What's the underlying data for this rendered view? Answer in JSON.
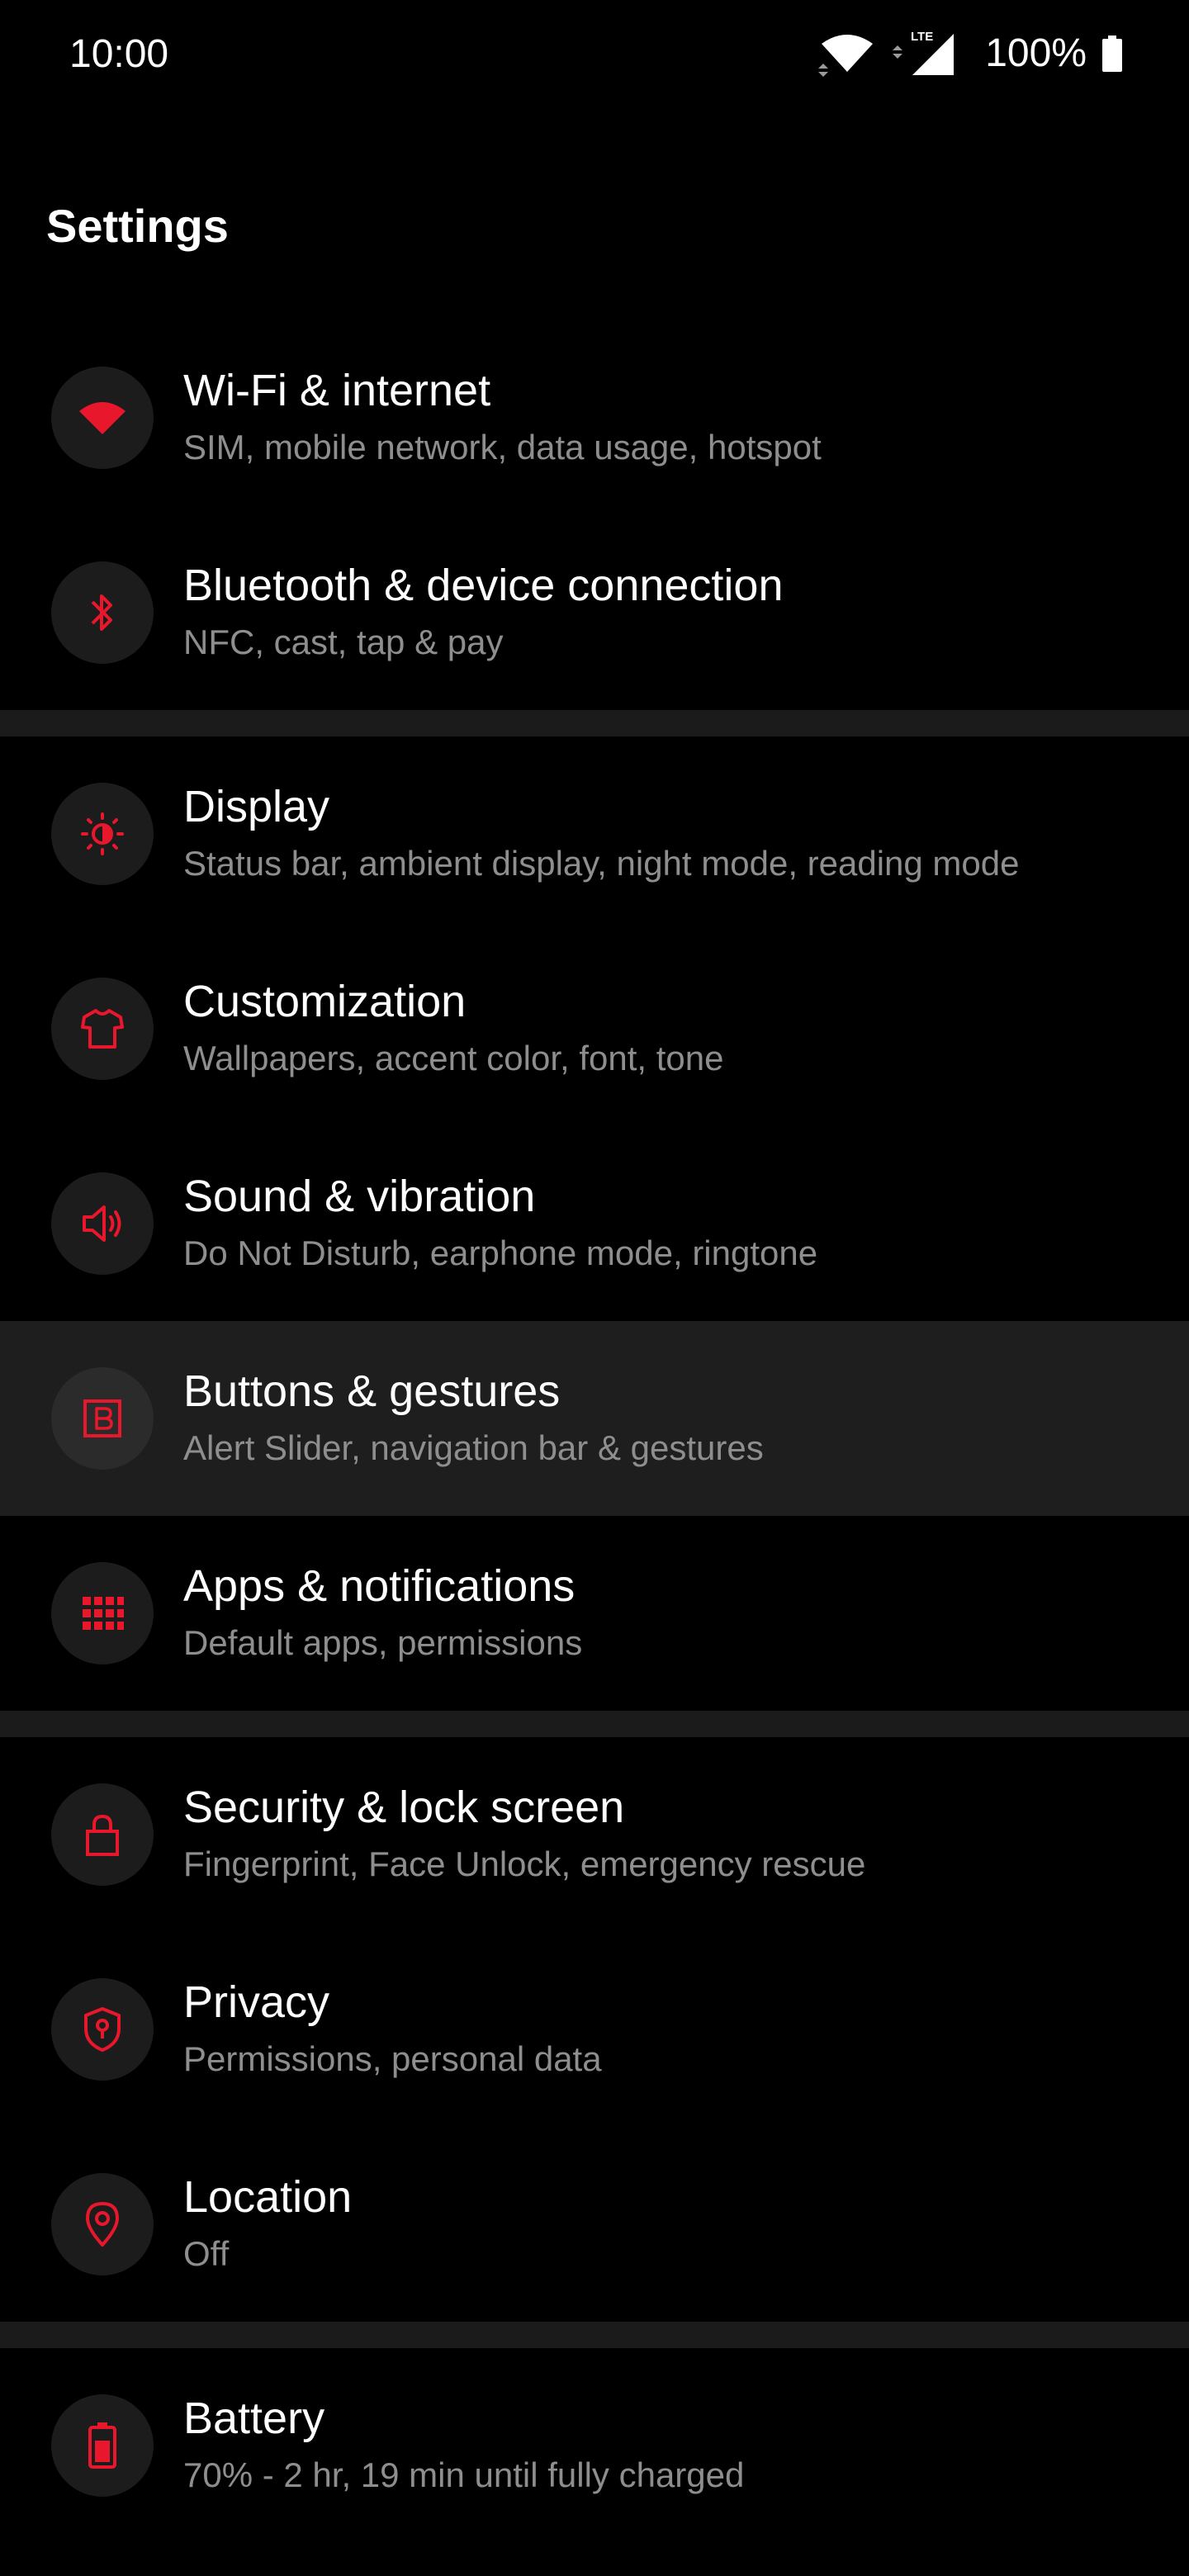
{
  "status_bar": {
    "time": "10:00",
    "battery_percent": "100%",
    "network_label": "LTE",
    "icons": [
      "wifi-icon",
      "mobile-signal-icon",
      "battery-icon"
    ]
  },
  "page": {
    "title": "Settings"
  },
  "accent_color": "#e8172c",
  "settings": [
    {
      "title": "Wi-Fi & internet",
      "subtitle": "SIM, mobile network, data usage, hotspot",
      "icon": "wifi-icon"
    },
    {
      "title": "Bluetooth & device connection",
      "subtitle": "NFC, cast, tap & pay",
      "icon": "bluetooth-icon"
    },
    {
      "title": "Display",
      "subtitle": "Status bar, ambient display, night mode, reading mode",
      "icon": "brightness-icon"
    },
    {
      "title": "Customization",
      "subtitle": "Wallpapers, accent color, font, tone",
      "icon": "tshirt-icon"
    },
    {
      "title": "Sound & vibration",
      "subtitle": "Do Not Disturb, earphone mode, ringtone",
      "icon": "speaker-icon"
    },
    {
      "title": "Buttons & gestures",
      "subtitle": "Alert Slider, navigation bar & gestures",
      "icon": "button-b-icon"
    },
    {
      "title": "Apps & notifications",
      "subtitle": "Default apps, permissions",
      "icon": "apps-grid-icon"
    },
    {
      "title": "Security & lock screen",
      "subtitle": "Fingerprint, Face Unlock, emergency rescue",
      "icon": "lock-icon"
    },
    {
      "title": "Privacy",
      "subtitle": "Permissions, personal data",
      "icon": "privacy-shield-icon"
    },
    {
      "title": "Location",
      "subtitle": "Off",
      "icon": "location-pin-icon"
    },
    {
      "title": "Battery",
      "subtitle": "70% - 2 hr, 19 min until fully charged",
      "icon": "battery-charging-icon"
    }
  ]
}
